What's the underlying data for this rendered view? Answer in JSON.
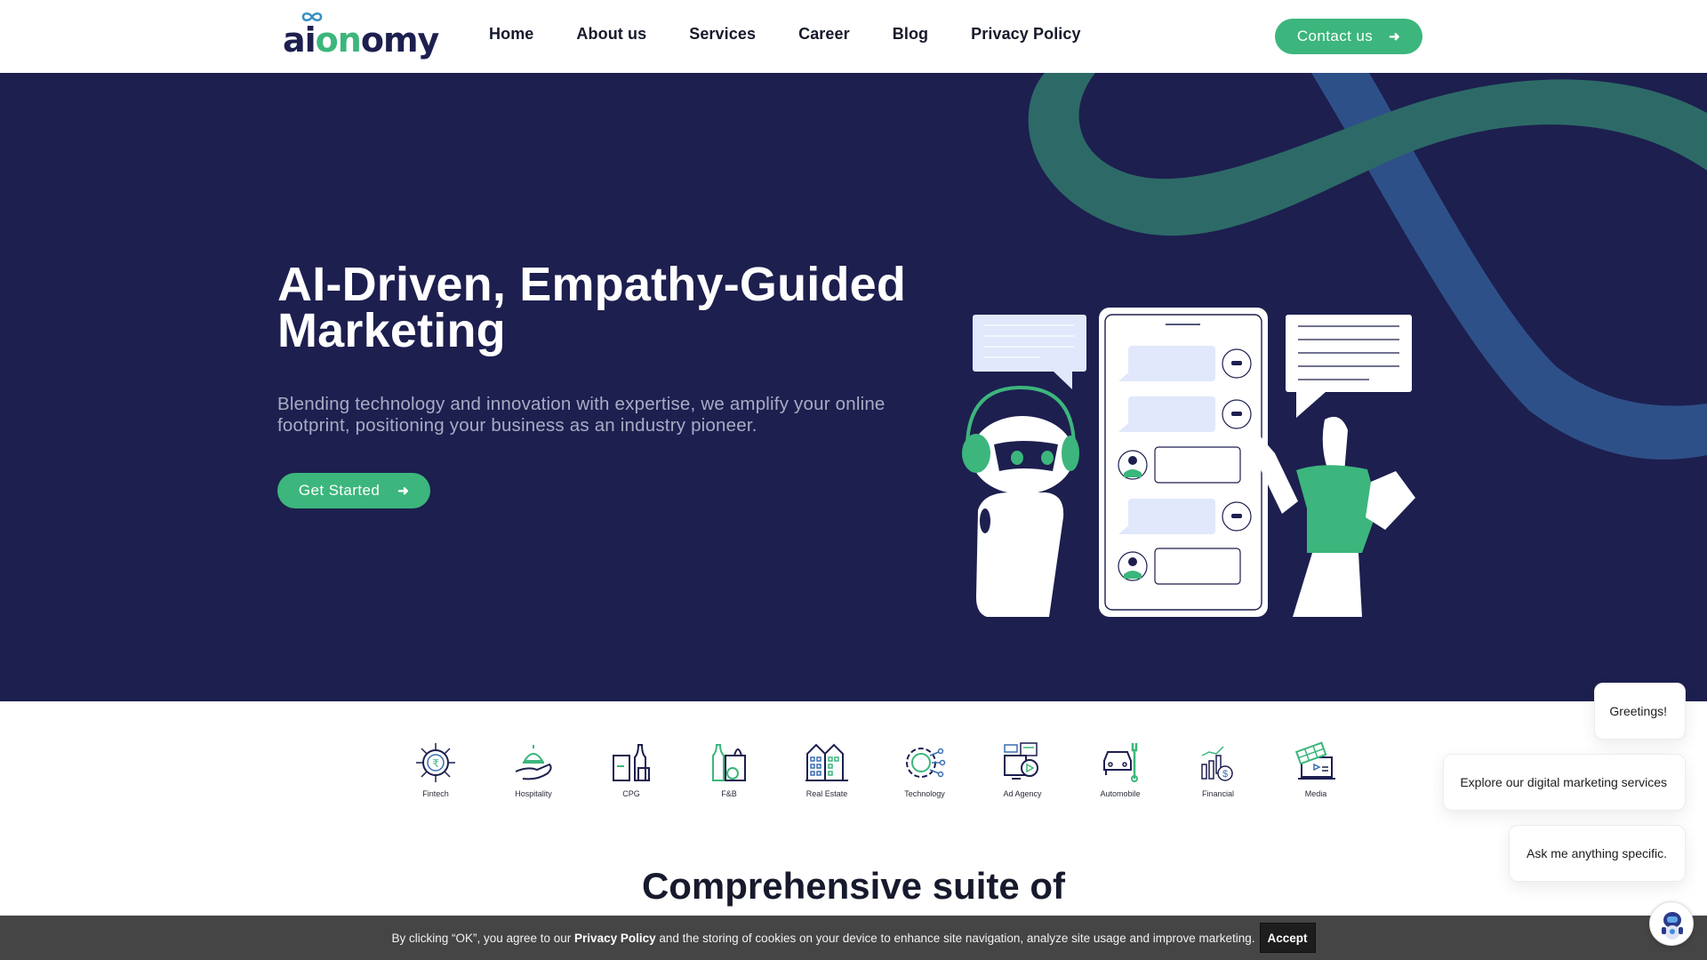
{
  "header": {
    "logo": {
      "part1": "ai",
      "part2": "on",
      "part3": "omy",
      "icon": "infinity-logo-icon"
    },
    "nav": [
      "Home",
      "About us",
      "Services",
      "Career",
      "Blog",
      "Privacy Policy"
    ],
    "contact_label": "Contact us",
    "contact_icon": "arrow-right-icon"
  },
  "hero": {
    "title_line1": "AI-Driven, Empathy-Guided",
    "title_line2": "Marketing",
    "subtitle_line1": "Blending technology and innovation with expertise, we amplify your online",
    "subtitle_line2": "footprint, positioning your business as an industry pioneer.",
    "cta_label": "Get Started",
    "cta_icon": "arrow-right-icon",
    "illustration": "chatbot-conversation-illustration"
  },
  "industries": [
    {
      "label": "Fintech",
      "icon": "rupee-chip-icon"
    },
    {
      "label": "Hospitality",
      "icon": "service-bell-icon"
    },
    {
      "label": "CPG",
      "icon": "packaged-goods-icon"
    },
    {
      "label": "F&B",
      "icon": "grocery-bag-icon"
    },
    {
      "label": "Real Estate",
      "icon": "buildings-icon"
    },
    {
      "label": "Technology",
      "icon": "gear-globe-icon"
    },
    {
      "label": "Ad Agency",
      "icon": "ad-media-icon"
    },
    {
      "label": "Automobile",
      "icon": "car-wrench-icon"
    },
    {
      "label": "Financial",
      "icon": "finance-chart-icon"
    },
    {
      "label": "Media",
      "icon": "media-laptop-icon"
    }
  ],
  "section": {
    "title": "Comprehensive suite of"
  },
  "chat": {
    "bubbles": [
      "Greetings!",
      "Explore our digital marketing services",
      "Ask me anything specific."
    ],
    "avatar_icon": "robot-avatar-icon"
  },
  "cookie": {
    "text_before": "By clicking “OK”, you agree to our ",
    "link": "Privacy Policy",
    "text_after": " and the storing of cookies on your device to enhance site navigation, analyze site usage and improve marketing.",
    "accept_label": "Accept"
  },
  "colors": {
    "brand_navy": "#1d1f4f",
    "brand_green": "#3cb67c",
    "swirl_green": "#2d6a67",
    "swirl_blue": "#2e5088",
    "cookie_bg": "#454545"
  }
}
